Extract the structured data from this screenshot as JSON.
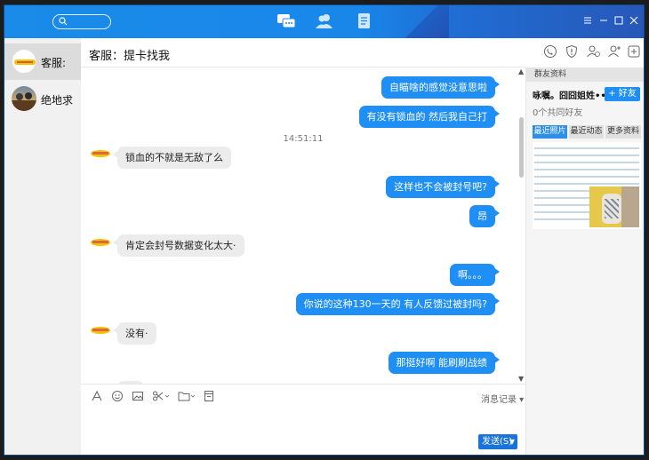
{
  "window": {
    "title_nav": [
      "chat-bubbles",
      "contacts",
      "files"
    ],
    "controls": [
      "menu",
      "minimize",
      "maximize",
      "close"
    ]
  },
  "sidebar": {
    "items": [
      {
        "label": "客服:",
        "selected": true
      },
      {
        "label": "绝地求",
        "selected": false
      }
    ]
  },
  "chat": {
    "title": "客服：提卡找我",
    "timestamp": "14:51:11",
    "messages": [
      {
        "side": "right",
        "text": "自瞄啥的感觉没意思啦"
      },
      {
        "side": "right",
        "text": "有没有锁血的   然后我自己打"
      },
      {
        "side": "left",
        "text": "锁血的不就是无敌了么"
      },
      {
        "side": "right",
        "text": "这样也不会被封号吧?"
      },
      {
        "side": "right",
        "text": "昂"
      },
      {
        "side": "left",
        "text": "肯定会封号数据变化太大·"
      },
      {
        "side": "right",
        "text": "啊。。。"
      },
      {
        "side": "right",
        "text": "你说的这种130一天的    有人反馈过被封吗?"
      },
      {
        "side": "left",
        "text": "没有·"
      },
      {
        "side": "right",
        "text": "那挺好啊   能刷刷战绩"
      }
    ]
  },
  "toolbar": {
    "history_label": "消息记录",
    "send_label": "发送(S)"
  },
  "right_panel": {
    "header": "群友资料",
    "name": "咏嘱。囧囧姐姓••",
    "add_friend": "+ 好友",
    "mutual_friends": "0个共同好友",
    "tabs": [
      "最近照片",
      "最近动态",
      "更多资料"
    ]
  },
  "colors": {
    "accent": "#1f8ef5",
    "titlebar": "#1a8be8"
  }
}
